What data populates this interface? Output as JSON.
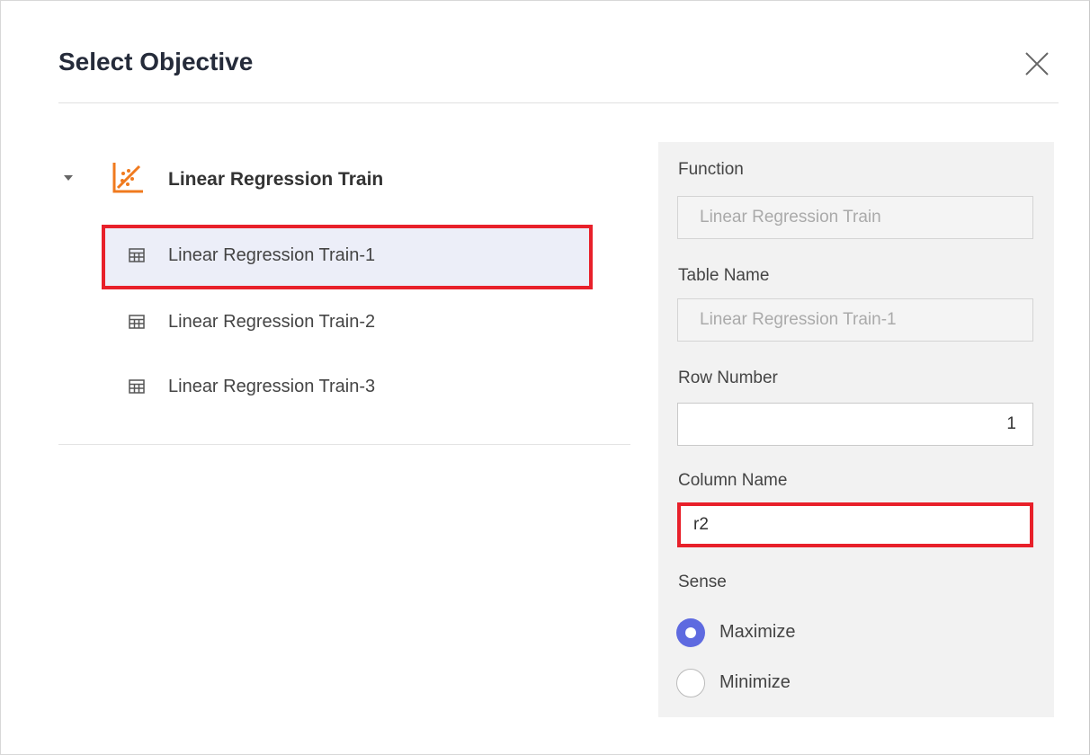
{
  "dialog": {
    "title": "Select Objective",
    "close_icon": "close-icon"
  },
  "tree": {
    "root": {
      "label": "Linear Regression Train",
      "icon": "regression-chart-icon",
      "expanded": true
    },
    "items": [
      {
        "label": "Linear Regression Train-1",
        "icon": "table-icon",
        "selected": true
      },
      {
        "label": "Linear Regression Train-2",
        "icon": "table-icon",
        "selected": false
      },
      {
        "label": "Linear Regression Train-3",
        "icon": "table-icon",
        "selected": false
      }
    ]
  },
  "form": {
    "function": {
      "label": "Function",
      "value": "Linear Regression Train"
    },
    "table_name": {
      "label": "Table Name",
      "value": "Linear Regression Train-1"
    },
    "row_number": {
      "label": "Row Number",
      "value": "1"
    },
    "column_name": {
      "label": "Column Name",
      "value": "r2"
    },
    "sense": {
      "label": "Sense",
      "options": [
        {
          "label": "Maximize",
          "selected": true
        },
        {
          "label": "Minimize",
          "selected": false
        }
      ]
    }
  },
  "colors": {
    "accent": "#5e6ae0",
    "highlight": "#e8202a",
    "brand_icon": "#f07a1e"
  }
}
